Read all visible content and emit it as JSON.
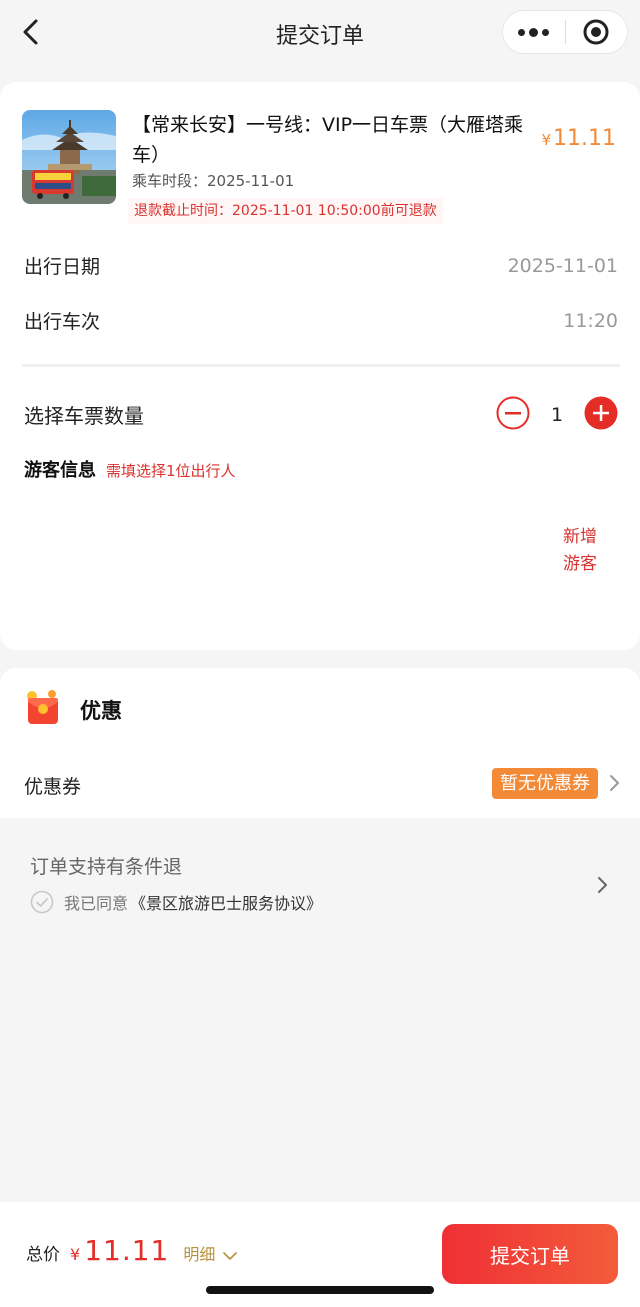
{
  "header": {
    "title": "提交订单"
  },
  "product": {
    "name": "【常来长安】一号线：VIP一日车票（大雁塔乘车）",
    "currency": "¥",
    "price": "11.11",
    "ride_time": "乘车时段：2025-11-01",
    "refund_deadline": "退款截止时间：2025-11-01 10:50:00前可退款"
  },
  "travel": {
    "date_label": "出行日期",
    "date_value": "2025-11-01",
    "trip_label": "出行车次",
    "trip_value": "11:20"
  },
  "quantity": {
    "label": "选择车票数量",
    "value": "1"
  },
  "visitor": {
    "title": "游客信息",
    "hint": "需填选择1位出行人",
    "add_label": "新增游客"
  },
  "discount": {
    "title": "优惠",
    "coupon_label": "优惠券",
    "coupon_value": "暂无优惠券"
  },
  "policy": {
    "refund_text": "订单支持有条件退",
    "agree_prefix": "我已同意",
    "agreement": "《景区旅游巴士服务协议》"
  },
  "footer": {
    "total_label": "总价",
    "currency": "¥",
    "total_amount": "11.11",
    "detail_label": "明细",
    "submit_label": "提交订单"
  },
  "colors": {
    "accent_red": "#e52d27",
    "price_orange": "#f28a38",
    "detail_gold": "#b8913e"
  }
}
